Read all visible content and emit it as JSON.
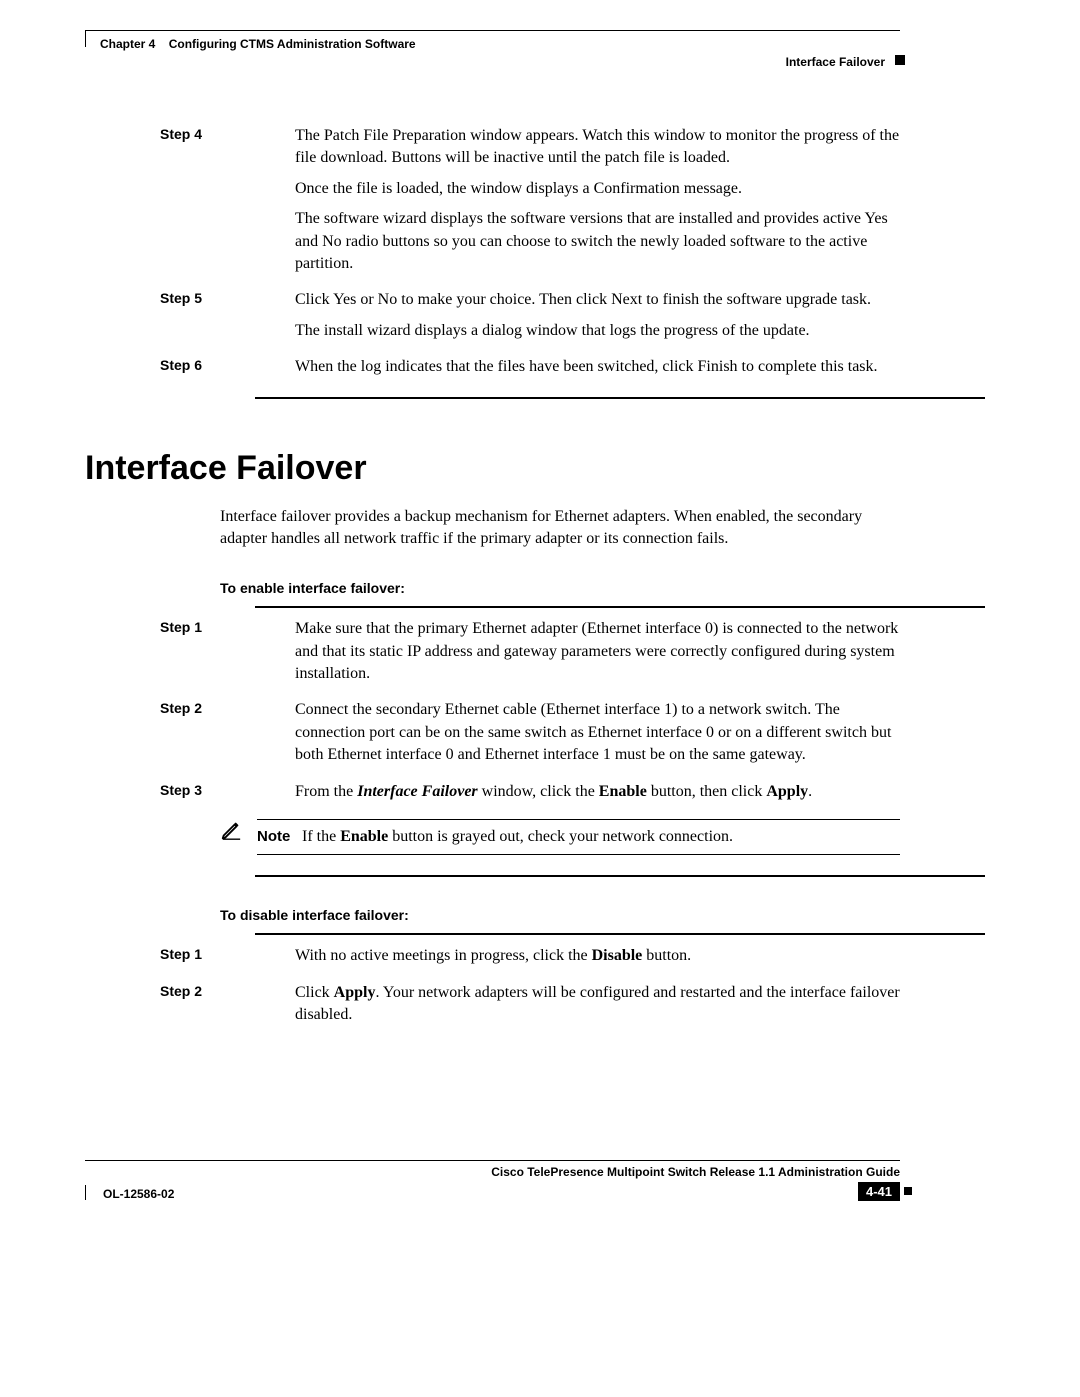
{
  "header": {
    "chapter_prefix": "Chapter 4",
    "chapter_title": "Configuring CTMS Administration Software",
    "section": "Interface Failover"
  },
  "top_steps": [
    {
      "label": "Step 4",
      "paras": [
        "The Patch File Preparation window appears. Watch this window to monitor the progress of the file download. Buttons will be inactive until the patch file is loaded.",
        "Once the file is loaded, the window displays a Confirmation message.",
        "The software wizard displays the software versions that are installed and provides active Yes and No radio buttons so you can choose to switch the newly loaded software to the active partition."
      ]
    },
    {
      "label": "Step 5",
      "paras": [
        "Click Yes or No to make your choice. Then click Next to finish the software upgrade task.",
        "The install wizard displays a dialog window that logs the progress of the update."
      ]
    },
    {
      "label": "Step 6",
      "paras": [
        "When the log indicates that the files have been switched, click Finish to complete this task."
      ]
    }
  ],
  "section_title": "Interface Failover",
  "intro": "Interface failover provides a backup mechanism for Ethernet adapters. When enabled, the secondary adapter handles all network traffic if the primary adapter or its connection fails.",
  "enable_hdr": "To enable interface failover:",
  "enable_steps": [
    {
      "label": "Step 1",
      "text": "Make sure that the primary Ethernet adapter (Ethernet interface 0) is connected to the network and that its static IP address and gateway parameters were correctly configured during system installation."
    },
    {
      "label": "Step 2",
      "text": "Connect the secondary Ethernet cable (Ethernet interface 1) to a network switch. The connection port can be on the same switch as Ethernet interface 0 or on a different switch but both Ethernet interface 0 and Ethernet interface 1 must be on the same gateway."
    },
    {
      "label": "Step 3",
      "html_parts": [
        "From the ",
        {
          "i": "Interface Failover"
        },
        " window, click the ",
        {
          "b": "Enable"
        },
        " button, then click ",
        {
          "b": "Apply"
        },
        "."
      ]
    }
  ],
  "note": {
    "label": "Note",
    "html_parts": [
      "If the ",
      {
        "b": "Enable"
      },
      " button is grayed out, check your network connection."
    ]
  },
  "disable_hdr": "To disable interface failover:",
  "disable_steps": [
    {
      "label": "Step 1",
      "html_parts": [
        "With no active meetings in progress, click the ",
        {
          "b": "Disable"
        },
        " button."
      ]
    },
    {
      "label": "Step 2",
      "html_parts": [
        "Click ",
        {
          "b": "Apply"
        },
        ". Your network adapters will be configured and restarted and the interface failover disabled."
      ]
    }
  ],
  "footer": {
    "guide": "Cisco TelePresence Multipoint Switch Release 1.1 Administration Guide",
    "doc": "OL-12586-02",
    "page": "4-41"
  }
}
